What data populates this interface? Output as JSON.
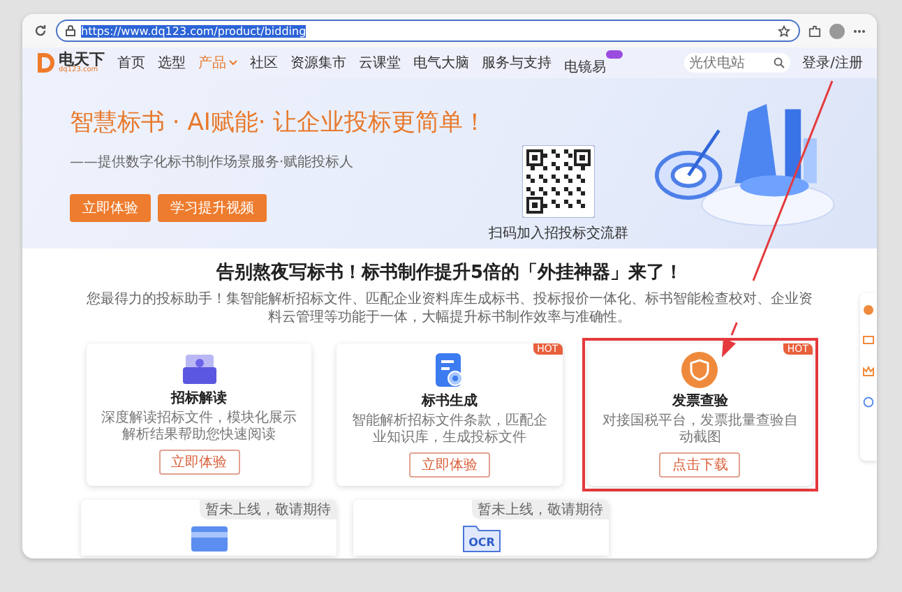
{
  "browser": {
    "url": "https://www.dq123.com/product/bidding",
    "url_selected": true
  },
  "nav": {
    "logo_text": "电天下",
    "logo_sub": "dq123.com",
    "items": [
      {
        "label": "首页",
        "selected": false,
        "dropdown": false,
        "badge": false
      },
      {
        "label": "选型",
        "selected": false,
        "dropdown": false,
        "badge": false
      },
      {
        "label": "产品",
        "selected": true,
        "dropdown": true,
        "badge": false
      },
      {
        "label": "社区",
        "selected": false,
        "dropdown": false,
        "badge": false
      },
      {
        "label": "资源集市",
        "selected": false,
        "dropdown": false,
        "badge": false
      },
      {
        "label": "云课堂",
        "selected": false,
        "dropdown": false,
        "badge": false
      },
      {
        "label": "电气大脑",
        "selected": false,
        "dropdown": false,
        "badge": false
      },
      {
        "label": "服务与支持",
        "selected": false,
        "dropdown": false,
        "badge": false
      },
      {
        "label": "电镜易",
        "selected": false,
        "dropdown": false,
        "badge": true
      }
    ],
    "search": {
      "placeholder": "光伏电站"
    },
    "login": "登录/注册"
  },
  "hero": {
    "title": "智慧标书 · AI赋能· 让企业投标更简单！",
    "subtitle": "——提供数字化标书制作场景服务·赋能投标人",
    "buttons": [
      "立即体验",
      "学习提升视频"
    ],
    "qr_caption": "扫码加入招投标交流群"
  },
  "section": {
    "heading": "告别熬夜写标书！标书制作提升5倍的「外挂神器」来了！",
    "intro": "您最得力的投标助手！集智能解析招标文件、匹配企业资料库生成标书、投标报价一体化、标书智能检查校对、企业资料云管理等功能于一体，大幅提升标书制作效率与准确性。"
  },
  "cards": [
    {
      "kind": "tray",
      "title": "招标解读",
      "desc": "深度解读招标文件，模块化展示解析结果帮助您快速阅读",
      "button": "立即体验",
      "highlighted": false
    },
    {
      "kind": "doc",
      "title": "标书生成",
      "desc": "智能解析招标文件条款，匹配企业知识库，生成投标文件",
      "button": "立即体验",
      "badge": "HOT",
      "highlighted": false
    },
    {
      "kind": "shield",
      "title": "发票查验",
      "desc": "对接国税平台，发票批量查验自动截图",
      "button": "点击下载",
      "badge": "HOT",
      "highlighted": true
    }
  ],
  "upcoming": [
    {
      "kind": "card",
      "ribbon": "暂未上线，敬请期待"
    },
    {
      "kind": "ocr",
      "ribbon": "暂未上线，敬请期待",
      "icon_text": "OCR"
    }
  ]
}
